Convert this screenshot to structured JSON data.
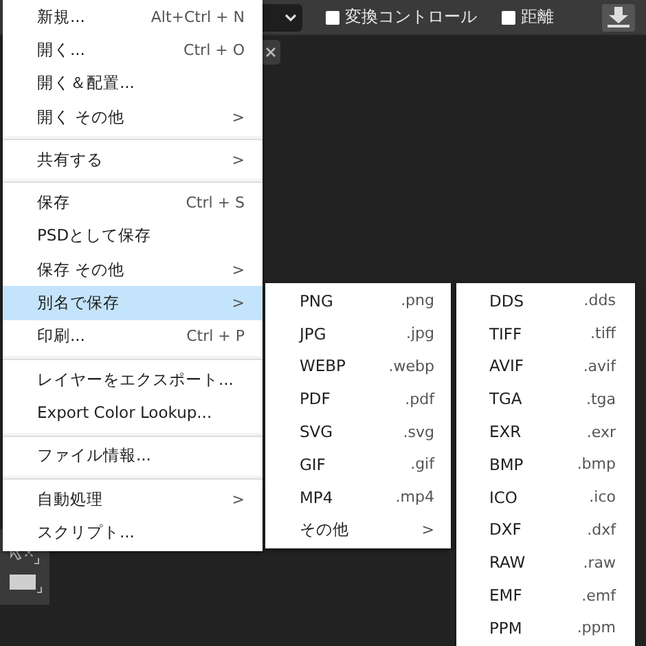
{
  "toolbar": {
    "options": [
      {
        "label": "変換コントロール",
        "checked": false
      },
      {
        "label": "距離",
        "checked": false
      }
    ]
  },
  "file_menu": {
    "items": [
      {
        "kind": "item",
        "label": "新規...",
        "shortcut": "Alt+Ctrl + N",
        "selected": false
      },
      {
        "kind": "item",
        "label": "開く...",
        "shortcut": "Ctrl + O",
        "selected": false
      },
      {
        "kind": "item",
        "label": "開く＆配置...",
        "selected": false
      },
      {
        "kind": "item",
        "label": "開く その他",
        "arrow": ">",
        "selected": false
      },
      {
        "kind": "separator"
      },
      {
        "kind": "item",
        "label": "共有する",
        "arrow": ">",
        "selected": false
      },
      {
        "kind": "separator"
      },
      {
        "kind": "item",
        "label": "保存",
        "shortcut": "Ctrl + S",
        "selected": false
      },
      {
        "kind": "item",
        "label": "PSDとして保存",
        "selected": false
      },
      {
        "kind": "item",
        "label": "保存 その他",
        "arrow": ">",
        "selected": false
      },
      {
        "kind": "item",
        "label": "別名で保存",
        "arrow": ">",
        "selected": true
      },
      {
        "kind": "item",
        "label": "印刷...",
        "shortcut": "Ctrl + P",
        "selected": false
      },
      {
        "kind": "separator"
      },
      {
        "kind": "item",
        "label": "レイヤーをエクスポート...",
        "selected": false
      },
      {
        "kind": "item",
        "label": "Export Color Lookup...",
        "selected": false
      },
      {
        "kind": "separator"
      },
      {
        "kind": "item",
        "label": "ファイル情報...",
        "selected": false
      },
      {
        "kind": "separator"
      },
      {
        "kind": "item",
        "label": "自動処理",
        "arrow": ">",
        "selected": false
      },
      {
        "kind": "item",
        "label": "スクリプト...",
        "selected": false
      }
    ]
  },
  "save_as_menu": {
    "items": [
      {
        "kind": "item",
        "label": "PNG",
        "shortcut": ".png",
        "selected": false
      },
      {
        "kind": "item",
        "label": "JPG",
        "shortcut": ".jpg",
        "selected": false
      },
      {
        "kind": "item",
        "label": "WEBP",
        "shortcut": ".webp",
        "selected": false
      },
      {
        "kind": "item",
        "label": "PDF",
        "shortcut": ".pdf",
        "selected": false
      },
      {
        "kind": "item",
        "label": "SVG",
        "shortcut": ".svg",
        "selected": false
      },
      {
        "kind": "item",
        "label": "GIF",
        "shortcut": ".gif",
        "selected": false
      },
      {
        "kind": "item",
        "label": "MP4",
        "shortcut": ".mp4",
        "selected": false
      },
      {
        "kind": "item",
        "label": "その他",
        "arrow": ">",
        "selected": false
      }
    ]
  },
  "other_formats_menu": {
    "items": [
      {
        "kind": "item",
        "label": "DDS",
        "shortcut": ".dds",
        "selected": false
      },
      {
        "kind": "item",
        "label": "TIFF",
        "shortcut": ".tiff",
        "selected": false
      },
      {
        "kind": "item",
        "label": "AVIF",
        "shortcut": ".avif",
        "selected": false
      },
      {
        "kind": "item",
        "label": "TGA",
        "shortcut": ".tga",
        "selected": false
      },
      {
        "kind": "item",
        "label": "EXR",
        "shortcut": ".exr",
        "selected": false
      },
      {
        "kind": "item",
        "label": "BMP",
        "shortcut": ".bmp",
        "selected": false
      },
      {
        "kind": "item",
        "label": "ICO",
        "shortcut": ".ico",
        "selected": false
      },
      {
        "kind": "item",
        "label": "DXF",
        "shortcut": ".dxf",
        "selected": false
      },
      {
        "kind": "item",
        "label": "RAW",
        "shortcut": ".raw",
        "selected": false
      },
      {
        "kind": "item",
        "label": "EMF",
        "shortcut": ".emf",
        "selected": false
      },
      {
        "kind": "item",
        "label": "PPM",
        "shortcut": ".ppm",
        "selected": false
      }
    ]
  }
}
